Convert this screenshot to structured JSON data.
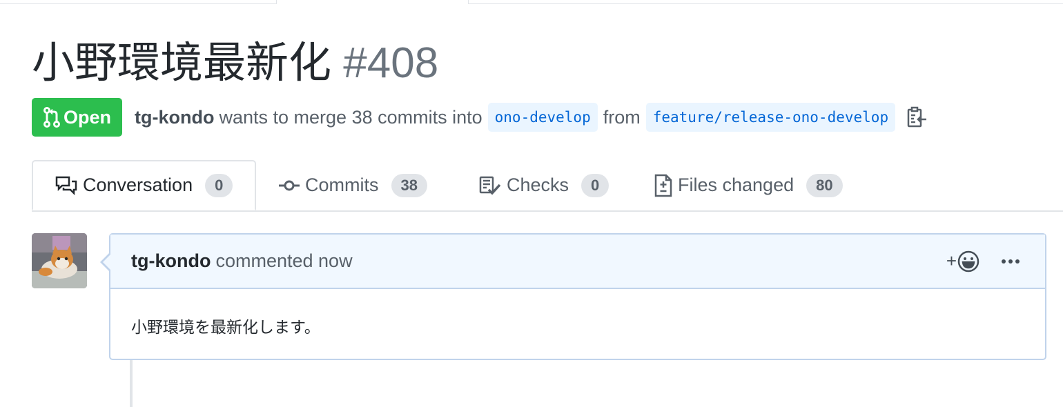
{
  "pr": {
    "title": "小野環境最新化",
    "number": "#408",
    "state": "Open",
    "author": "tg-kondo",
    "merge_text": "wants to merge 38 commits into",
    "base_branch": "ono-develop",
    "from_text": "from",
    "head_branch": "feature/release-ono-develop"
  },
  "tabs": [
    {
      "label": "Conversation",
      "count": "0",
      "icon": "comment-discussion-icon"
    },
    {
      "label": "Commits",
      "count": "38",
      "icon": "git-commit-icon"
    },
    {
      "label": "Checks",
      "count": "0",
      "icon": "checklist-icon"
    },
    {
      "label": "Files changed",
      "count": "80",
      "icon": "diff-icon"
    }
  ],
  "comment": {
    "author": "tg-kondo",
    "meta": "commented now",
    "reaction_label": "+",
    "body": "小野環境を最新化します。"
  },
  "colors": {
    "open_green": "#2cbe4e",
    "link_blue": "#0366d6",
    "branch_bg": "#eaf5ff",
    "comment_header_bg": "#f1f8ff",
    "comment_border": "#c0d3eb"
  }
}
